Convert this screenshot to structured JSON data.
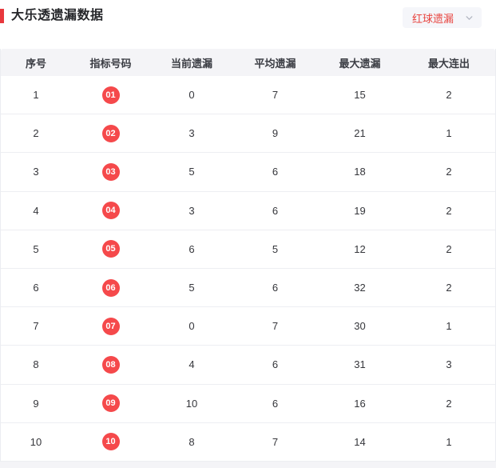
{
  "page": {
    "title": "大乐透遗漏数据"
  },
  "filter": {
    "selected": "红球遗漏",
    "icon": "chevron-down-icon"
  },
  "colors": {
    "accent_red": "#e8383d",
    "ball_red": "#f5494b",
    "dropdown_text_red": "#e8443f",
    "header_bg": "#f4f4f7",
    "divider": "#edeef2"
  },
  "table": {
    "columns": [
      "序号",
      "指标号码",
      "当前遗漏",
      "平均遗漏",
      "最大遗漏",
      "最大连出"
    ],
    "rows": [
      {
        "seq": "1",
        "ball": "01",
        "current": "0",
        "average": "7",
        "max_miss": "15",
        "max_streak": "2"
      },
      {
        "seq": "2",
        "ball": "02",
        "current": "3",
        "average": "9",
        "max_miss": "21",
        "max_streak": "1"
      },
      {
        "seq": "3",
        "ball": "03",
        "current": "5",
        "average": "6",
        "max_miss": "18",
        "max_streak": "2"
      },
      {
        "seq": "4",
        "ball": "04",
        "current": "3",
        "average": "6",
        "max_miss": "19",
        "max_streak": "2"
      },
      {
        "seq": "5",
        "ball": "05",
        "current": "6",
        "average": "5",
        "max_miss": "12",
        "max_streak": "2"
      },
      {
        "seq": "6",
        "ball": "06",
        "current": "5",
        "average": "6",
        "max_miss": "32",
        "max_streak": "2"
      },
      {
        "seq": "7",
        "ball": "07",
        "current": "0",
        "average": "7",
        "max_miss": "30",
        "max_streak": "1"
      },
      {
        "seq": "8",
        "ball": "08",
        "current": "4",
        "average": "6",
        "max_miss": "31",
        "max_streak": "3"
      },
      {
        "seq": "9",
        "ball": "09",
        "current": "10",
        "average": "6",
        "max_miss": "16",
        "max_streak": "2"
      },
      {
        "seq": "10",
        "ball": "10",
        "current": "8",
        "average": "7",
        "max_miss": "14",
        "max_streak": "1"
      }
    ]
  }
}
